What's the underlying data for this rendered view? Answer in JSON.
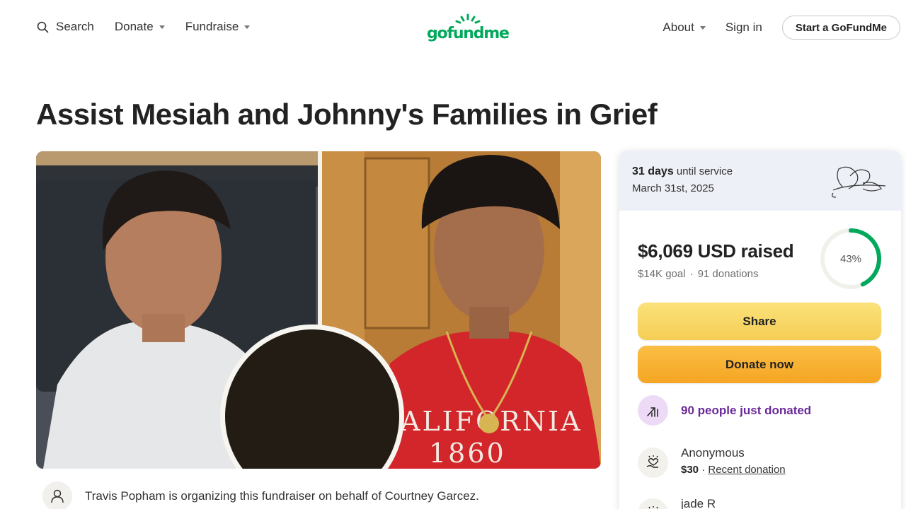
{
  "header": {
    "search_label": "Search",
    "donate_label": "Donate",
    "fundraise_label": "Fundraise",
    "logo_text": "gofundme",
    "about_label": "About",
    "signin_label": "Sign in",
    "start_label": "Start a GoFundMe",
    "brand_color": "#02a95c"
  },
  "campaign": {
    "title": "Assist Mesiah and Johnny's Families in Grief",
    "organizer_text": "Travis Popham is organizing this fundraiser on behalf of Courtney Garcez."
  },
  "card": {
    "days_bold": "31 days",
    "days_rest": "until service",
    "service_date": "March 31st, 2025",
    "raised": "$6,069 USD raised",
    "goal": "$14K goal",
    "separator": "·",
    "donations": "91 donations",
    "progress_percent": 43,
    "progress_label": "43%",
    "share_label": "Share",
    "donate_now_label": "Donate now",
    "just_donated": "90 people just donated",
    "donors": [
      {
        "name": "Anonymous",
        "amount": "$30",
        "sep": "·",
        "tag": "Recent donation"
      },
      {
        "name": "jade R"
      }
    ]
  }
}
